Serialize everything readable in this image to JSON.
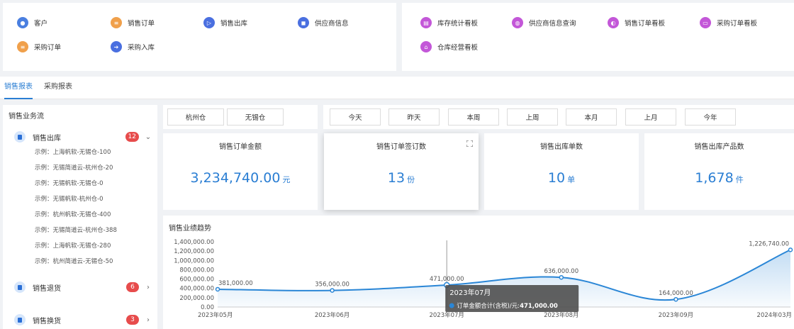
{
  "quick_links_left": [
    {
      "label": "客户",
      "icon": "user-icon",
      "color": "#4a7fe0"
    },
    {
      "label": "销售订单",
      "icon": "order-icon",
      "color": "#f0a04b"
    },
    {
      "label": "销售出库",
      "icon": "send-icon",
      "color": "#4a6fe0"
    },
    {
      "label": "供应商信息",
      "icon": "supplier-icon",
      "color": "#4a6fe0"
    },
    {
      "label": "采购订单",
      "icon": "purchase-order-icon",
      "color": "#f0a04b"
    },
    {
      "label": "采购入库",
      "icon": "inbound-icon",
      "color": "#4a6fe0"
    }
  ],
  "quick_links_right": [
    {
      "label": "库存统计看板",
      "icon": "inventory-icon",
      "color": "#c357d8"
    },
    {
      "label": "供应商信息查询",
      "icon": "supplier-query-icon",
      "color": "#c357d8"
    },
    {
      "label": "销售订单看板",
      "icon": "sales-board-icon",
      "color": "#c357d8"
    },
    {
      "label": "采购订单看板",
      "icon": "purchase-board-icon",
      "color": "#c357d8"
    },
    {
      "label": "仓库经营看板",
      "icon": "warehouse-icon",
      "color": "#c357d8"
    }
  ],
  "tabs": [
    {
      "label": "销售报表",
      "active": true
    },
    {
      "label": "采购报表",
      "active": false
    }
  ],
  "sidebar": {
    "title": "销售业务流",
    "groups": [
      {
        "label": "销售出库",
        "badge": "12",
        "chevron": "⌄",
        "expanded": true,
        "items": [
          "示例：上海帆软-无锡仓-100",
          "示例：无锡简道云-杭州仓-20",
          "示例：无锡帆软-无锡仓-0",
          "示例：无锡帆软-杭州仓-0",
          "示例：杭州帆软-无锡仓-400",
          "示例：无锡简道云-杭州仓-388",
          "示例：上海帆软-无锡仓-280",
          "示例：杭州简道云-无锡仓-50"
        ]
      },
      {
        "label": "销售退货",
        "badge": "6",
        "chevron": "›",
        "expanded": false,
        "items": []
      },
      {
        "label": "销售换货",
        "badge": "3",
        "chevron": "›",
        "expanded": false,
        "items": []
      }
    ]
  },
  "warehouse_filters": [
    "杭州仓",
    "无锡仓"
  ],
  "date_filters": [
    "今天",
    "昨天",
    "本周",
    "上周",
    "本月",
    "上月",
    "今年"
  ],
  "cards": [
    {
      "title": "销售订单金额",
      "value": "3,234,740.00",
      "unit": "元"
    },
    {
      "title": "销售订单签订数",
      "value": "13",
      "unit": "份"
    },
    {
      "title": "销售出库单数",
      "value": "10",
      "unit": "单"
    },
    {
      "title": "销售出库产品数",
      "value": "1,678",
      "unit": "件"
    }
  ],
  "chart_data": {
    "type": "area",
    "title": "销售业绩趋势",
    "categories": [
      "2023年05月",
      "2023年06月",
      "2023年07月",
      "2023年08月",
      "2023年09月",
      "2024年03月"
    ],
    "series": [
      {
        "name": "订单金额合计(含税)/元",
        "values": [
          381000,
          356000,
          471000,
          636000,
          164000,
          1226740
        ]
      }
    ],
    "data_labels": [
      "381,000.00",
      "356,000.00",
      "471,000.00",
      "636,000.00",
      "164,000.00",
      "1,226,740.00"
    ],
    "y_ticks": [
      "0.00",
      "200,000.00",
      "400,000.00",
      "600,000.00",
      "800,000.00",
      "1,000,000.00",
      "1,200,000.00",
      "1,400,000.00"
    ],
    "ylim": [
      0,
      1400000
    ],
    "grid": false,
    "color": "#2a86d6",
    "tooltip": {
      "title": "2023年07月",
      "label": "订单金额合计(含税)/元:",
      "value": "471,000.00"
    }
  }
}
